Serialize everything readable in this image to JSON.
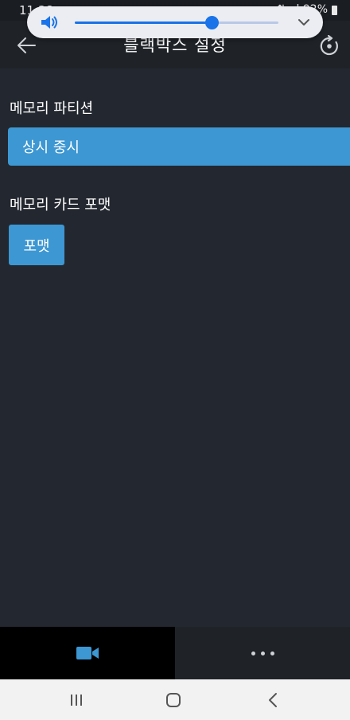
{
  "status_bar": {
    "time": "11:28",
    "right_text": "⇅ .ıl 92%"
  },
  "volume": {
    "level": 0.67,
    "accent_color": "#1a73e8",
    "icon": "speaker-icon",
    "expand_icon": "chevron-down-icon"
  },
  "header": {
    "title": "블랙박스 설정",
    "back_icon": "arrow-left-icon",
    "refresh_icon": "refresh-icon"
  },
  "memory_partition": {
    "label": "메모리 파티션",
    "selected_value": "상시 중시"
  },
  "memory_card_format": {
    "label": "메모리 카드 포맷",
    "button_label": "포맷"
  },
  "tab_bar": {
    "tabs": [
      {
        "icon": "video-camera-icon",
        "active": true
      },
      {
        "icon": "more-dots-icon",
        "active": false
      }
    ]
  },
  "nav_bar": {
    "buttons": [
      "recents-icon",
      "home-icon",
      "back-icon"
    ]
  },
  "colors": {
    "background": "#23272f",
    "button": "#3d97d2"
  }
}
